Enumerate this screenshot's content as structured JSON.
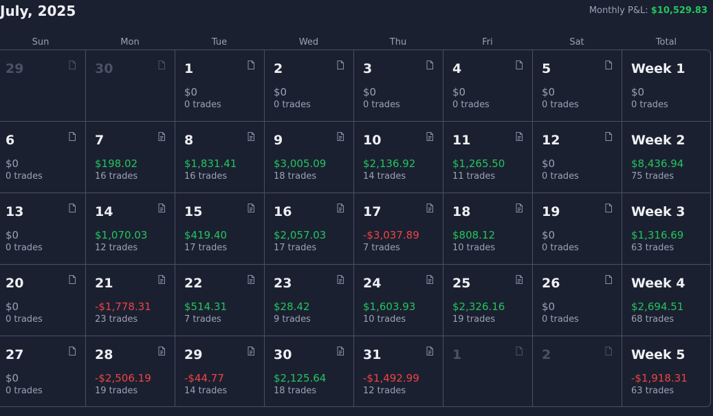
{
  "header": {
    "month_title": "July, 2025",
    "pnl_label": "Monthly P&L:",
    "pnl_value": "$10,529.83"
  },
  "days_of_week": [
    "Sun",
    "Mon",
    "Tue",
    "Wed",
    "Thu",
    "Fri",
    "Sat",
    "Total"
  ],
  "colors": {
    "positive": "#22c55e",
    "negative": "#ef4444",
    "neutral": "#9aa2b4"
  },
  "weeks": [
    {
      "days": [
        {
          "date": "29",
          "muted": true,
          "icon": "blank-note-icon"
        },
        {
          "date": "30",
          "muted": true,
          "icon": "blank-note-icon"
        },
        {
          "date": "1",
          "amount": "$0",
          "trades": "0 trades",
          "tone": "zero",
          "icon": "blank-note-icon"
        },
        {
          "date": "2",
          "amount": "$0",
          "trades": "0 trades",
          "tone": "zero",
          "icon": "blank-note-icon"
        },
        {
          "date": "3",
          "amount": "$0",
          "trades": "0 trades",
          "tone": "zero",
          "icon": "blank-note-icon"
        },
        {
          "date": "4",
          "amount": "$0",
          "trades": "0 trades",
          "tone": "zero",
          "icon": "blank-note-icon"
        },
        {
          "date": "5",
          "amount": "$0",
          "trades": "0 trades",
          "tone": "zero",
          "icon": "blank-note-icon"
        }
      ],
      "total": {
        "label": "Week 1",
        "amount": "$0",
        "trades": "0 trades",
        "tone": "zero"
      }
    },
    {
      "days": [
        {
          "date": "6",
          "amount": "$0",
          "trades": "0 trades",
          "tone": "zero",
          "icon": "blank-note-icon"
        },
        {
          "date": "7",
          "amount": "$198.02",
          "trades": "16 trades",
          "tone": "pos",
          "icon": "note-icon"
        },
        {
          "date": "8",
          "amount": "$1,831.41",
          "trades": "16 trades",
          "tone": "pos",
          "icon": "note-icon"
        },
        {
          "date": "9",
          "amount": "$3,005.09",
          "trades": "18 trades",
          "tone": "pos",
          "icon": "note-icon"
        },
        {
          "date": "10",
          "amount": "$2,136.92",
          "trades": "14 trades",
          "tone": "pos",
          "icon": "note-icon"
        },
        {
          "date": "11",
          "amount": "$1,265.50",
          "trades": "11 trades",
          "tone": "pos",
          "icon": "note-icon"
        },
        {
          "date": "12",
          "amount": "$0",
          "trades": "0 trades",
          "tone": "zero",
          "icon": "blank-note-icon"
        }
      ],
      "total": {
        "label": "Week 2",
        "amount": "$8,436.94",
        "trades": "75 trades",
        "tone": "pos"
      }
    },
    {
      "days": [
        {
          "date": "13",
          "amount": "$0",
          "trades": "0 trades",
          "tone": "zero",
          "icon": "blank-note-icon"
        },
        {
          "date": "14",
          "amount": "$1,070.03",
          "trades": "12 trades",
          "tone": "pos",
          "icon": "note-icon"
        },
        {
          "date": "15",
          "amount": "$419.40",
          "trades": "17 trades",
          "tone": "pos",
          "icon": "note-icon"
        },
        {
          "date": "16",
          "amount": "$2,057.03",
          "trades": "17 trades",
          "tone": "pos",
          "icon": "note-icon"
        },
        {
          "date": "17",
          "amount": "-$3,037.89",
          "trades": "7 trades",
          "tone": "neg",
          "icon": "note-icon"
        },
        {
          "date": "18",
          "amount": "$808.12",
          "trades": "10 trades",
          "tone": "pos",
          "icon": "note-icon"
        },
        {
          "date": "19",
          "amount": "$0",
          "trades": "0 trades",
          "tone": "zero",
          "icon": "blank-note-icon"
        }
      ],
      "total": {
        "label": "Week 3",
        "amount": "$1,316.69",
        "trades": "63 trades",
        "tone": "pos"
      }
    },
    {
      "days": [
        {
          "date": "20",
          "amount": "$0",
          "trades": "0 trades",
          "tone": "zero",
          "icon": "blank-note-icon"
        },
        {
          "date": "21",
          "amount": "-$1,778.31",
          "trades": "23 trades",
          "tone": "neg",
          "icon": "note-icon"
        },
        {
          "date": "22",
          "amount": "$514.31",
          "trades": "7 trades",
          "tone": "pos",
          "icon": "note-icon"
        },
        {
          "date": "23",
          "amount": "$28.42",
          "trades": "9 trades",
          "tone": "pos",
          "icon": "note-icon"
        },
        {
          "date": "24",
          "amount": "$1,603.93",
          "trades": "10 trades",
          "tone": "pos",
          "icon": "note-icon"
        },
        {
          "date": "25",
          "amount": "$2,326.16",
          "trades": "19 trades",
          "tone": "pos",
          "icon": "note-icon"
        },
        {
          "date": "26",
          "amount": "$0",
          "trades": "0 trades",
          "tone": "zero",
          "icon": "blank-note-icon"
        }
      ],
      "total": {
        "label": "Week 4",
        "amount": "$2,694.51",
        "trades": "68 trades",
        "tone": "pos"
      }
    },
    {
      "days": [
        {
          "date": "27",
          "amount": "$0",
          "trades": "0 trades",
          "tone": "zero",
          "icon": "blank-note-icon"
        },
        {
          "date": "28",
          "amount": "-$2,506.19",
          "trades": "19 trades",
          "tone": "neg",
          "icon": "note-icon"
        },
        {
          "date": "29",
          "amount": "-$44.77",
          "trades": "14 trades",
          "tone": "neg",
          "icon": "note-icon"
        },
        {
          "date": "30",
          "amount": "$2,125.64",
          "trades": "18 trades",
          "tone": "pos",
          "icon": "note-icon"
        },
        {
          "date": "31",
          "amount": "-$1,492.99",
          "trades": "12 trades",
          "tone": "neg",
          "icon": "note-icon"
        },
        {
          "date": "1",
          "muted": true,
          "icon": "blank-note-icon"
        },
        {
          "date": "2",
          "muted": true,
          "icon": "blank-note-icon"
        }
      ],
      "total": {
        "label": "Week 5",
        "amount": "-$1,918.31",
        "trades": "63 trades",
        "tone": "neg"
      }
    }
  ]
}
